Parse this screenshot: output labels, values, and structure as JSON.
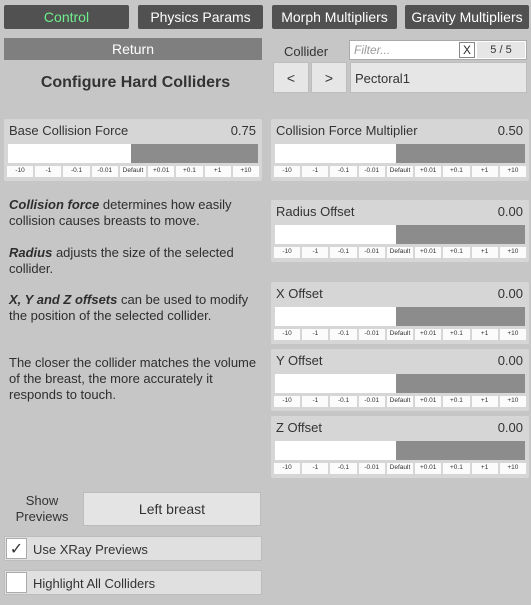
{
  "tabs": [
    {
      "label": "Control",
      "active": true
    },
    {
      "label": "Physics Params",
      "active": false
    },
    {
      "label": "Morph Multipliers",
      "active": false
    },
    {
      "label": "Gravity Multipliers",
      "active": false
    }
  ],
  "return_label": "Return",
  "title": "Configure Hard Colliders",
  "collider": {
    "label": "Collider",
    "filter_placeholder": "Filter...",
    "clear_label": "X",
    "count": "5 / 5",
    "prev_label": "<",
    "next_label": ">",
    "selected": "Pectoral1"
  },
  "step_labels": [
    "-10",
    "-1",
    "-0.1",
    "-0.01",
    "Default",
    "+0.01",
    "+0.1",
    "+1",
    "+10"
  ],
  "sliders": {
    "base_collision_force": {
      "label": "Base Collision Force",
      "value": "0.75",
      "fill": 0.5
    },
    "collision_force_multiplier": {
      "label": "Collision Force Multiplier",
      "value": "0.50",
      "fill": 0.49
    },
    "radius_offset": {
      "label": "Radius Offset",
      "value": "0.00",
      "fill": 0.49
    },
    "x_offset": {
      "label": "X Offset",
      "value": "0.00",
      "fill": 0.49
    },
    "y_offset": {
      "label": "Y Offset",
      "value": "0.00",
      "fill": 0.49
    },
    "z_offset": {
      "label": "Z Offset",
      "value": "0.00",
      "fill": 0.49
    }
  },
  "help": {
    "p1_bold": "Collision force",
    "p1_rest": " determines how easily collision causes breasts to move.",
    "p2_bold": "Radius",
    "p2_rest": " adjusts the size of the selected collider.",
    "p3_bold": "X, Y and Z offsets",
    "p3_rest": " can be used to modify the position of the selected collider.",
    "p4": "The closer the collider matches the volume of the breast, the more accurately it responds to touch."
  },
  "show_previews_label": "Show Previews",
  "preview_target": "Left breast",
  "toggles": {
    "xray": {
      "label": "Use XRay Previews",
      "checked": true
    },
    "highlight": {
      "label": "Highlight All Colliders",
      "checked": false
    }
  }
}
